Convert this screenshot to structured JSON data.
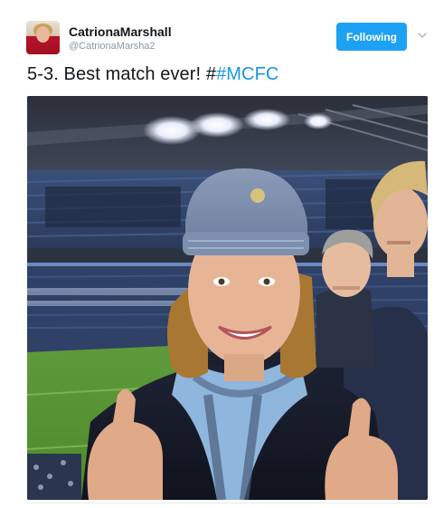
{
  "tweet": {
    "author_name": "CatrionaMarshall",
    "author_handle": "@CatrionaMarsha2",
    "follow_button_label": "Following",
    "text_prefix": "5-3. Best match ever! #",
    "hashtag": "#MCFC"
  },
  "icons": {
    "avatar": "avatar-image",
    "menu": "chevron-down-icon"
  },
  "colors": {
    "follow_button": "#1da1f2",
    "hashtag": "#1b95e0",
    "handle": "#8899a6"
  }
}
